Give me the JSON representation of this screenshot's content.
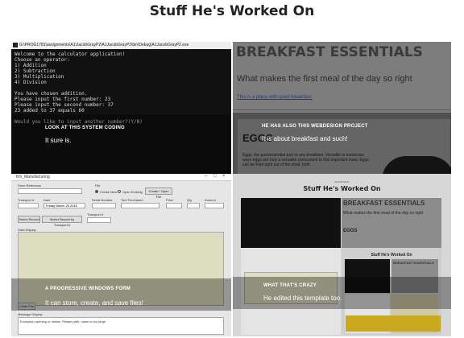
{
  "page": {
    "title": "Stuff He's Worked On"
  },
  "tile1": {
    "window_title": "G:\\PROG1781\\assignments\\A1\\JacobGrayP2\\A1JacobGrayP2\\bin\\Debug\\A1JacobGrayP2.exe",
    "console_lines": [
      "Welcome to the calculator application!",
      "Choose an operator:",
      "1) Addition",
      "2) Subtraction",
      "3) Multiplication",
      "4) Division",
      "",
      "You have chosen addition.",
      "Please input the first number: 23",
      "Please input the second number: 37",
      "23 added to 37 equals 60",
      "",
      "Would you like to input another number?(Y/N)"
    ],
    "caption_label": "LOOK AT THIS SYSTEM CODING",
    "caption_text": "It sure is."
  },
  "tile2": {
    "site_title": "BREAKFAST ESSENTIALS",
    "site_subtitle": "What makes the first meal of the day so right",
    "site_link": "This is a place with good breakfast.",
    "card_heading": "EGGS",
    "card_paragraph": "Eggs, the quintessential part to any breakfast. Versatile in numerous ways eggs are truly a versatile component to this important meal. Eggs can be fried right out of the shell, both",
    "caption_label": "HE HAS ALSO THIS WEBDESIGN PROJECT",
    "caption_text": "It is about breakfast and such!"
  },
  "tile3": {
    "window_title": "frm_Manufacturing",
    "labels": {
      "store_reference": "Store Reference",
      "file": "File",
      "create_new": "Create New",
      "open_existing": "Open Existing",
      "create_open": "Create / Open File",
      "transport": "Transport #",
      "date": "Date",
      "serial_number": "Serial Number",
      "tool_purchased": "Tool Purchased",
      "price": "Price",
      "qty": "Qty",
      "amount": "Amount",
      "select_record": "Select Record",
      "select_record_transport": "Select Record by Transport #",
      "transport_2": "Transport #",
      "data_display": "Data Display",
      "close_file": "Close File",
      "messages": "Message Display",
      "message_text": "Exception opening or create. Please path, name is too large"
    },
    "date_fields": [
      "Friday",
      "March",
      "25",
      "2016"
    ],
    "caption_label": "A PROGRESSIVE WINDOWS FORM",
    "caption_text": "It can store, create, and save files!"
  },
  "tile4": {
    "small_header": "JACOB GRAY",
    "title": "Stuff He's Worked On",
    "web_title": "BREAKFAST ESSENTIALS",
    "web_subtitle": "What makes the first meal of the day so right",
    "web_card": "EGGS",
    "nested_title": "Stuff He's Worked On",
    "nested_web_title": "BREAKFAST ESSENTIALS",
    "caption_label": "WHAT THAT'S CRAZY",
    "caption_text": "He edited this template too."
  }
}
